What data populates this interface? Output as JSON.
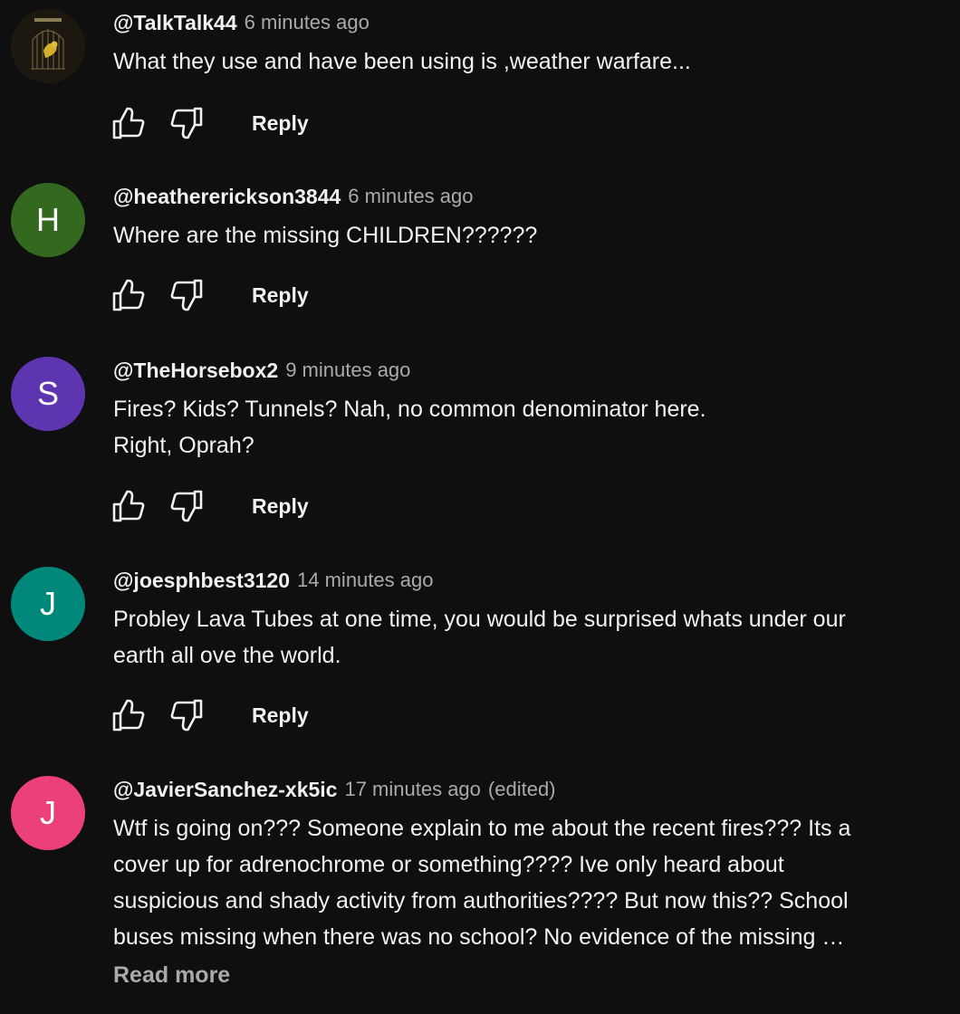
{
  "comments": [
    {
      "avatar_letter": "",
      "avatar_color": "#2a2418",
      "author": "@TalkTalk44",
      "time": "6 minutes ago",
      "lines": [
        "What they use and have been using is ,weather warfare..."
      ],
      "reply_label": "Reply"
    },
    {
      "avatar_letter": "H",
      "avatar_color": "#33691e",
      "author": "@heathererickson3844",
      "time": "6 minutes ago",
      "lines": [
        "Where are the missing CHILDREN??????"
      ],
      "reply_label": "Reply"
    },
    {
      "avatar_letter": "S",
      "avatar_color": "#5e35b1",
      "author": "@TheHorsebox2",
      "time": "9 minutes ago",
      "lines": [
        "Fires? Kids? Tunnels? Nah, no common denominator here.",
        "Right, Oprah?"
      ],
      "reply_label": "Reply"
    },
    {
      "avatar_letter": "J",
      "avatar_color": "#00897b",
      "author": "@joesphbest3120",
      "time": "14 minutes ago",
      "lines": [
        "Probley Lava Tubes at one time, you would be surprised whats under our",
        "earth all ove the world."
      ],
      "reply_label": "Reply"
    },
    {
      "avatar_letter": "J",
      "avatar_color": "#ec407a",
      "author": "@JavierSanchez-xk5ic",
      "time": "17 minutes ago",
      "edited": "(edited)",
      "lines": [
        "Wtf is going on??? Someone explain to me about the recent fires??? Its a",
        "cover up for adrenochrome or something???? Ive only heard about",
        "suspicious and shady activity from authorities???? But now this?? School",
        "buses missing when there was no school? No evidence of the missing …"
      ],
      "read_more": "Read more"
    }
  ]
}
